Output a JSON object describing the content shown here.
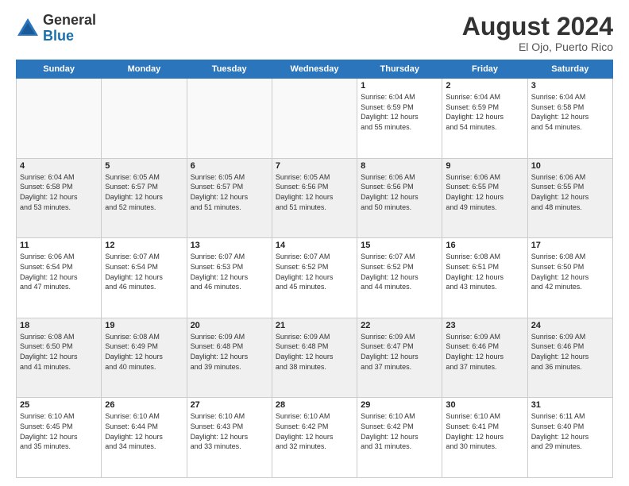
{
  "header": {
    "logo_general": "General",
    "logo_blue": "Blue",
    "month_year": "August 2024",
    "location": "El Ojo, Puerto Rico"
  },
  "days_of_week": [
    "Sunday",
    "Monday",
    "Tuesday",
    "Wednesday",
    "Thursday",
    "Friday",
    "Saturday"
  ],
  "weeks": [
    [
      {
        "day": "",
        "info": ""
      },
      {
        "day": "",
        "info": ""
      },
      {
        "day": "",
        "info": ""
      },
      {
        "day": "",
        "info": ""
      },
      {
        "day": "1",
        "info": "Sunrise: 6:04 AM\nSunset: 6:59 PM\nDaylight: 12 hours\nand 55 minutes."
      },
      {
        "day": "2",
        "info": "Sunrise: 6:04 AM\nSunset: 6:59 PM\nDaylight: 12 hours\nand 54 minutes."
      },
      {
        "day": "3",
        "info": "Sunrise: 6:04 AM\nSunset: 6:58 PM\nDaylight: 12 hours\nand 54 minutes."
      }
    ],
    [
      {
        "day": "4",
        "info": "Sunrise: 6:04 AM\nSunset: 6:58 PM\nDaylight: 12 hours\nand 53 minutes."
      },
      {
        "day": "5",
        "info": "Sunrise: 6:05 AM\nSunset: 6:57 PM\nDaylight: 12 hours\nand 52 minutes."
      },
      {
        "day": "6",
        "info": "Sunrise: 6:05 AM\nSunset: 6:57 PM\nDaylight: 12 hours\nand 51 minutes."
      },
      {
        "day": "7",
        "info": "Sunrise: 6:05 AM\nSunset: 6:56 PM\nDaylight: 12 hours\nand 51 minutes."
      },
      {
        "day": "8",
        "info": "Sunrise: 6:06 AM\nSunset: 6:56 PM\nDaylight: 12 hours\nand 50 minutes."
      },
      {
        "day": "9",
        "info": "Sunrise: 6:06 AM\nSunset: 6:55 PM\nDaylight: 12 hours\nand 49 minutes."
      },
      {
        "day": "10",
        "info": "Sunrise: 6:06 AM\nSunset: 6:55 PM\nDaylight: 12 hours\nand 48 minutes."
      }
    ],
    [
      {
        "day": "11",
        "info": "Sunrise: 6:06 AM\nSunset: 6:54 PM\nDaylight: 12 hours\nand 47 minutes."
      },
      {
        "day": "12",
        "info": "Sunrise: 6:07 AM\nSunset: 6:54 PM\nDaylight: 12 hours\nand 46 minutes."
      },
      {
        "day": "13",
        "info": "Sunrise: 6:07 AM\nSunset: 6:53 PM\nDaylight: 12 hours\nand 46 minutes."
      },
      {
        "day": "14",
        "info": "Sunrise: 6:07 AM\nSunset: 6:52 PM\nDaylight: 12 hours\nand 45 minutes."
      },
      {
        "day": "15",
        "info": "Sunrise: 6:07 AM\nSunset: 6:52 PM\nDaylight: 12 hours\nand 44 minutes."
      },
      {
        "day": "16",
        "info": "Sunrise: 6:08 AM\nSunset: 6:51 PM\nDaylight: 12 hours\nand 43 minutes."
      },
      {
        "day": "17",
        "info": "Sunrise: 6:08 AM\nSunset: 6:50 PM\nDaylight: 12 hours\nand 42 minutes."
      }
    ],
    [
      {
        "day": "18",
        "info": "Sunrise: 6:08 AM\nSunset: 6:50 PM\nDaylight: 12 hours\nand 41 minutes."
      },
      {
        "day": "19",
        "info": "Sunrise: 6:08 AM\nSunset: 6:49 PM\nDaylight: 12 hours\nand 40 minutes."
      },
      {
        "day": "20",
        "info": "Sunrise: 6:09 AM\nSunset: 6:48 PM\nDaylight: 12 hours\nand 39 minutes."
      },
      {
        "day": "21",
        "info": "Sunrise: 6:09 AM\nSunset: 6:48 PM\nDaylight: 12 hours\nand 38 minutes."
      },
      {
        "day": "22",
        "info": "Sunrise: 6:09 AM\nSunset: 6:47 PM\nDaylight: 12 hours\nand 37 minutes."
      },
      {
        "day": "23",
        "info": "Sunrise: 6:09 AM\nSunset: 6:46 PM\nDaylight: 12 hours\nand 37 minutes."
      },
      {
        "day": "24",
        "info": "Sunrise: 6:09 AM\nSunset: 6:46 PM\nDaylight: 12 hours\nand 36 minutes."
      }
    ],
    [
      {
        "day": "25",
        "info": "Sunrise: 6:10 AM\nSunset: 6:45 PM\nDaylight: 12 hours\nand 35 minutes."
      },
      {
        "day": "26",
        "info": "Sunrise: 6:10 AM\nSunset: 6:44 PM\nDaylight: 12 hours\nand 34 minutes."
      },
      {
        "day": "27",
        "info": "Sunrise: 6:10 AM\nSunset: 6:43 PM\nDaylight: 12 hours\nand 33 minutes."
      },
      {
        "day": "28",
        "info": "Sunrise: 6:10 AM\nSunset: 6:42 PM\nDaylight: 12 hours\nand 32 minutes."
      },
      {
        "day": "29",
        "info": "Sunrise: 6:10 AM\nSunset: 6:42 PM\nDaylight: 12 hours\nand 31 minutes."
      },
      {
        "day": "30",
        "info": "Sunrise: 6:10 AM\nSunset: 6:41 PM\nDaylight: 12 hours\nand 30 minutes."
      },
      {
        "day": "31",
        "info": "Sunrise: 6:11 AM\nSunset: 6:40 PM\nDaylight: 12 hours\nand 29 minutes."
      }
    ]
  ]
}
